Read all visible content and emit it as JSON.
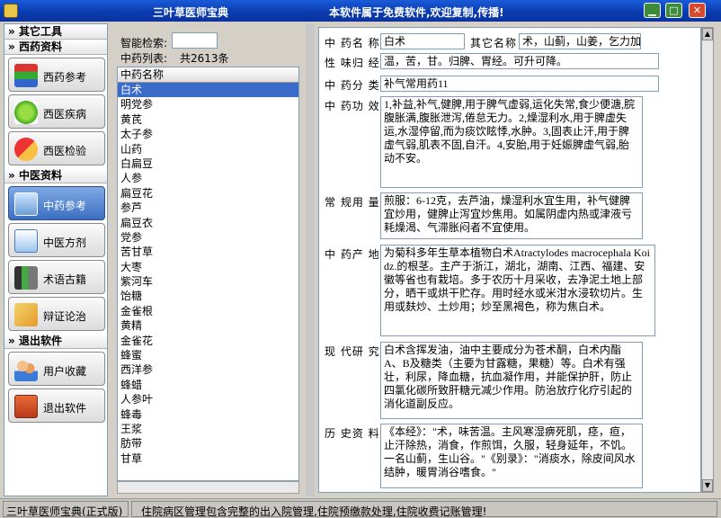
{
  "window": {
    "app_title": "三叶草医师宝典",
    "banner": "本软件属于免费软件,欢迎复制,传播!"
  },
  "sidebar": {
    "sections": [
      {
        "label": "其它工具",
        "buttons": []
      },
      {
        "label": "西药资料",
        "buttons": [
          "西药参考",
          "西医疾病",
          "西医检验"
        ]
      },
      {
        "label": "中医资料",
        "buttons": [
          "中药参考",
          "中医方剂",
          "术语古籍",
          "辩证论治"
        ]
      },
      {
        "label": "退出软件",
        "buttons": [
          "用户收藏",
          "退出软件"
        ]
      }
    ]
  },
  "search": {
    "label": "智能检索:",
    "value": "",
    "count_label": "中药列表:",
    "count_value": "共2613条"
  },
  "list": {
    "header": "中药名称",
    "items": [
      "白术",
      "明党参",
      "黄芪",
      "太子参",
      "山药",
      "白扁豆",
      "人参",
      "扁豆花",
      "参芦",
      "扁豆衣",
      "党参",
      "苦甘草",
      "大枣",
      "紫河车",
      "饴糖",
      "金雀根",
      "黄精",
      "金雀花",
      "蜂蜜",
      "西洋参",
      "蜂蜡",
      "人参叶",
      "蜂毒",
      "王浆",
      "肪带",
      "甘草"
    ],
    "selected_index": 0
  },
  "detail": {
    "name_label": "中 药名 称",
    "name_value": "白术",
    "alias_label": "其它名称",
    "alias_value": "术，山蓟，山姜，乞力加，",
    "nature_label": "性 味归 经",
    "nature_value": "温，苦，甘。归脾、胃经。可升可降。",
    "category_label": "中 药分 类",
    "category_value": "补气常用药11",
    "effect_label": "中 药功 效",
    "effect_value": "1,补益,补气,健脾,用于脾气虚弱,运化失常,食少便溏,脘腹胀满,腹胀泄泻,倦怠无力。2,燥湿利水,用于脾虚失运,水湿停留,而为痰饮眩悸,水肿。3,固表止汗,用于脾虚气弱,肌表不固,自汗。4,安胎,用于妊娠脾虚气弱,胎动不安。",
    "dosage_label": "常 规用 量",
    "dosage_value": "煎服：6-12克，去芦油，燥湿利水宜生用，补气健脾宜炒用，健脾止泻宜炒焦用。如属阴虚内热或津液亏耗燥渴、气滞胀闷者不宜使用。",
    "origin_label": "中 药产 地",
    "origin_value": "为菊科多年生草本植物白术Atractylodes macrocephala Koidz.的根茎。主产于浙江，湖北，湖南、江西、福建、安徽等省也有栽培。多于农历十月采收，去净泥土地上部分，晒干或烘干贮存。用时经水或米泔水浸软切片。生用或麸炒、土炒用；炒至黑褐色，称为焦白术。",
    "research_label": "现 代研 究",
    "research_value": "白术含挥发油，油中主要成分为苍术酮，白术内酯A、B及糖类（主要为甘露糖，果糖）等。白术有强壮，利尿，降血糖，抗血凝作用，并能保护肝，防止四氯化碳所致肝糖元减少作用。防治放疗化疗引起的消化道副反应。",
    "history_label": "历 史资 料",
    "history_value": "《本经》：\"术，味苦温。主风寒湿痹死肌，痉，疸，止汗除热，消食，作煎饵，久服，轻身延年，不饥。一名山蓟，生山谷。\"《别录》：\"消痰水，除皮间风水结肿，暖胃消谷嗜食。\""
  },
  "status": {
    "left": "三叶草医师宝典(正式版)",
    "right": "住院病区管理包含完整的出入院管理,住院预缴款处理,住院收费记账管理!"
  },
  "colors": {
    "titlebar": "#0a3cb0",
    "selection": "#3a6bc8",
    "active_button": "#3c6fc2"
  },
  "icons": [
    "app-icon",
    "books-icon",
    "pill-icon",
    "capsule-icon",
    "herb-box-icon",
    "prescription-icon",
    "ancient-book-icon",
    "scroll-icon",
    "users-icon",
    "exit-door-icon"
  ]
}
